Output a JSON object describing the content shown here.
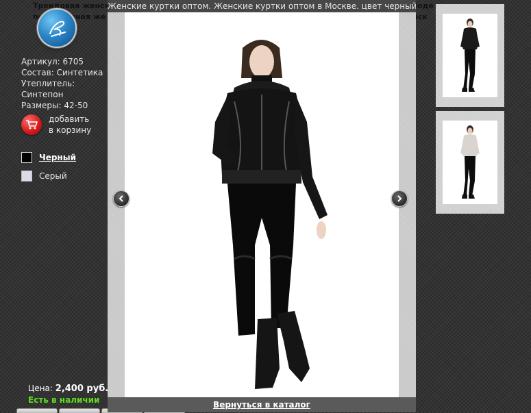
{
  "background_description": {
    "line1_left": "Трендовая женск",
    "line1_right": "Моде",
    "line2_left": "пс",
    "line2_mid": "вная же",
    "line2_right": "ыск"
  },
  "product": {
    "article": "Артикул: 6705",
    "composition": "Состав: Синтетика",
    "insulation_label": "Утеплитель:",
    "insulation_value": "Синтепон",
    "sizes": "Размеры: 42-50"
  },
  "cart": {
    "line1": "добавить",
    "line2": "в корзину"
  },
  "colors": [
    {
      "label": "Черный",
      "hex": "#000000",
      "selected": true
    },
    {
      "label": "Серый",
      "hex": "#dcdce6",
      "selected": false
    }
  ],
  "price": {
    "label": "Цена:",
    "value": "2,400 руб."
  },
  "stock": "Есть в наличии",
  "lightbox": {
    "title": "Женские куртки оптом. Женские куртки оптом в Москве. цвет черный",
    "back_link": "Вернуться в каталог"
  },
  "thumbnails": [
    {
      "color": "black"
    },
    {
      "color": "grey"
    }
  ],
  "palette": {
    "accent_green": "#5edc1f",
    "cart_red": "#d01818",
    "logo_blue": "#2b86c8"
  }
}
